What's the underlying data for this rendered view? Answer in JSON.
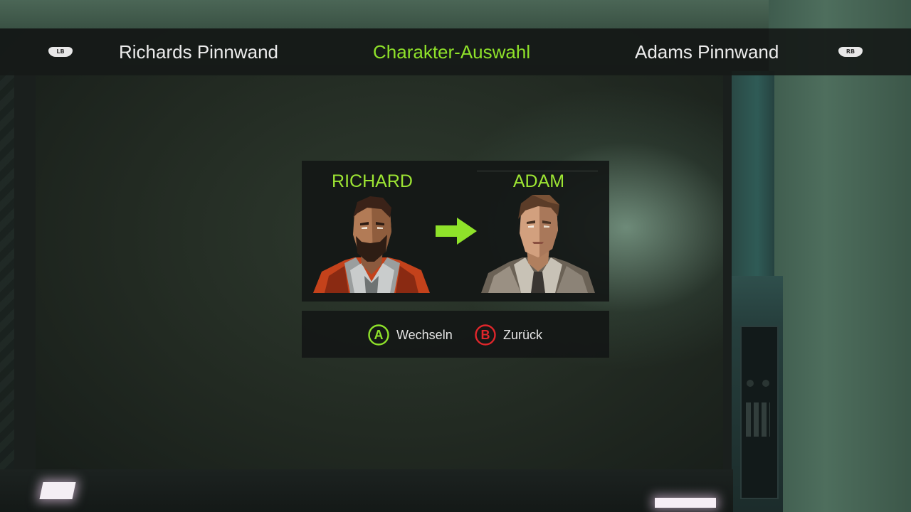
{
  "header": {
    "left_bumper": "LB",
    "right_bumper": "RB",
    "tabs": [
      {
        "label": "Richards Pinnwand",
        "active": false
      },
      {
        "label": "Charakter-Auswahl",
        "active": true
      },
      {
        "label": "Adams Pinnwand",
        "active": false
      }
    ]
  },
  "character_swap": {
    "from": {
      "name": "RICHARD",
      "portrait": "richard-portrait"
    },
    "to": {
      "name": "ADAM",
      "portrait": "adam-portrait"
    },
    "arrow_icon": "arrow-right-icon"
  },
  "prompts": [
    {
      "button": "A",
      "label": "Wechseln",
      "color": "#8fe22a"
    },
    {
      "button": "B",
      "label": "Zurück",
      "color": "#e0262b"
    }
  ],
  "colors": {
    "accent": "#8fe22a",
    "text": "#ececec",
    "panel": "#141716"
  }
}
